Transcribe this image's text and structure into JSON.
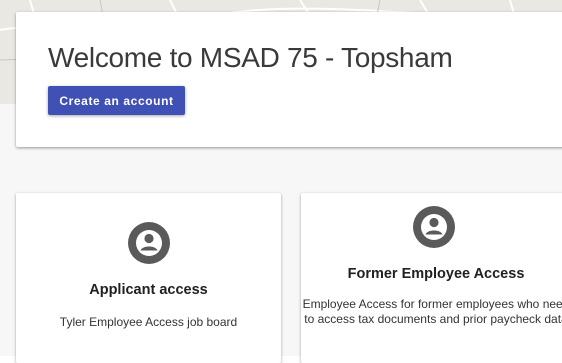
{
  "header": {
    "title": "Welcome to MSAD 75 - Topsham",
    "create_account_label": "Create an account"
  },
  "tiles": [
    {
      "title": "Applicant access",
      "description": "Tyler Employee Access job board",
      "icon": "account-circle-icon"
    },
    {
      "title": "Former Employee Access",
      "description": "Employee Access for former employees who need to access tax documents and prior paycheck data",
      "icon": "account-circle-icon"
    }
  ],
  "colors": {
    "primary": "#3f51b5",
    "icon": "#5a5a5a",
    "page_background": "#f7f7f7"
  }
}
